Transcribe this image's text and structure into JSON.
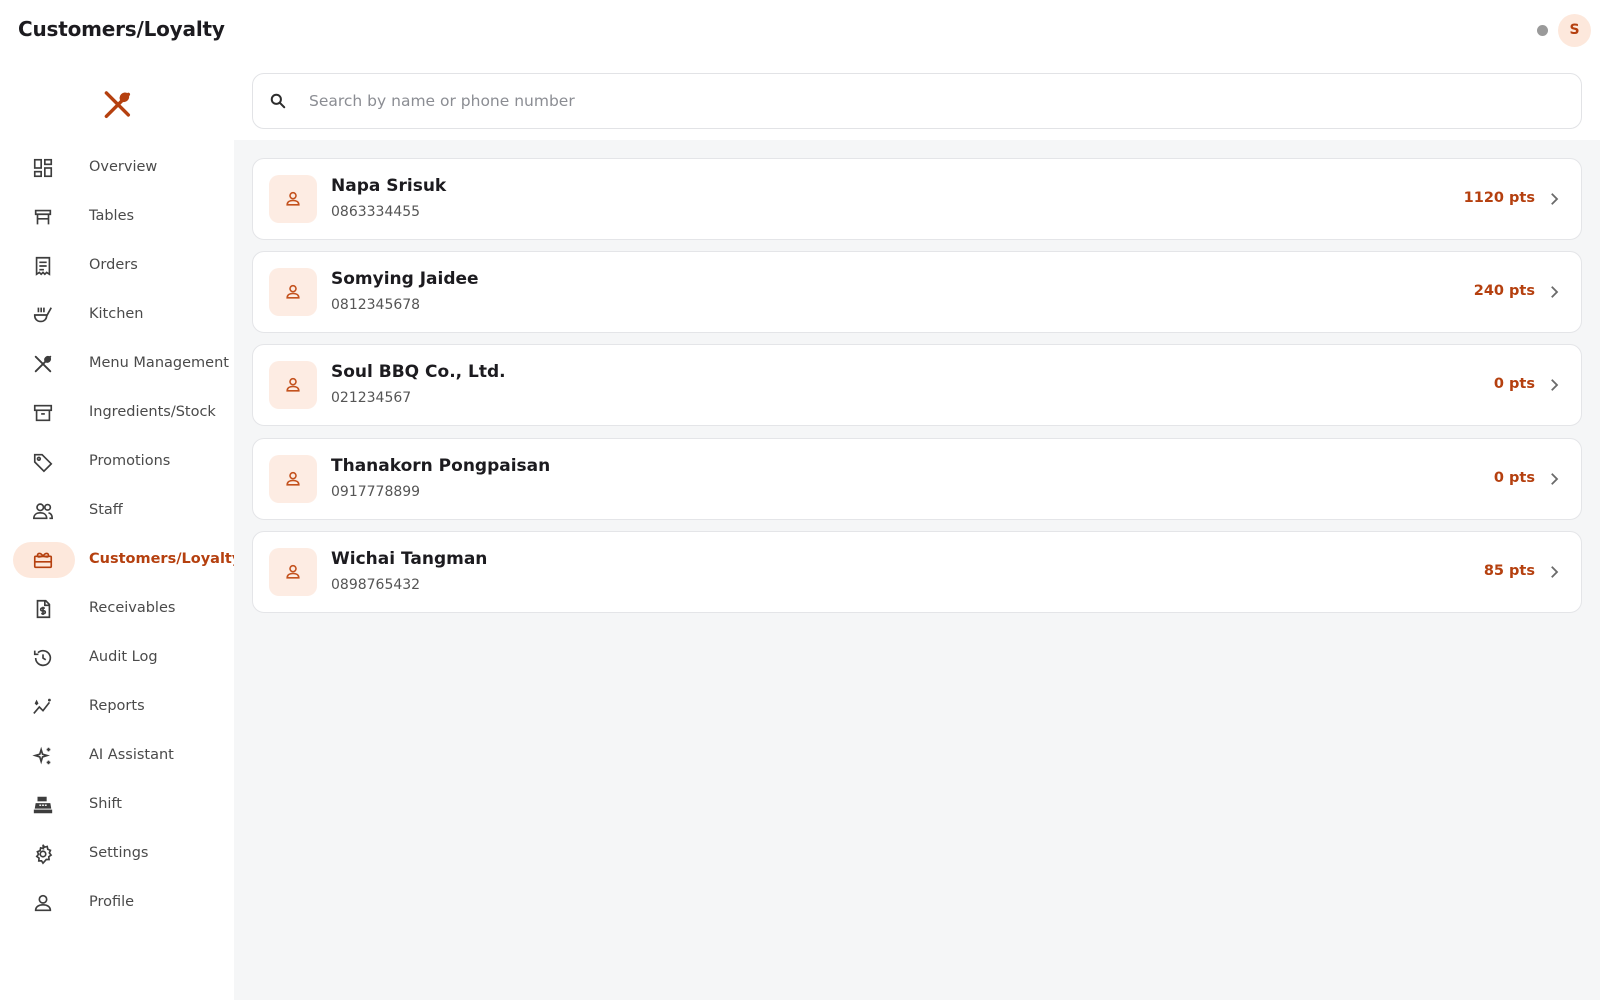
{
  "header": {
    "title": "Customers/Loyalty",
    "avatar_initial": "S"
  },
  "sidebar": {
    "items": [
      {
        "label": "Overview",
        "icon": "dashboard-icon"
      },
      {
        "label": "Tables",
        "icon": "table-icon"
      },
      {
        "label": "Orders",
        "icon": "receipt-icon"
      },
      {
        "label": "Kitchen",
        "icon": "kitchen-icon"
      },
      {
        "label": "Menu Management",
        "icon": "utensils-icon"
      },
      {
        "label": "Ingredients/Stock",
        "icon": "archive-box-icon"
      },
      {
        "label": "Promotions",
        "icon": "tag-icon"
      },
      {
        "label": "Staff",
        "icon": "people-icon"
      },
      {
        "label": "Customers/Loyalty",
        "icon": "loyalty-card-icon",
        "active": true
      },
      {
        "label": "Receivables",
        "icon": "invoice-dollar-icon"
      },
      {
        "label": "Audit Log",
        "icon": "history-icon"
      },
      {
        "label": "Reports",
        "icon": "trend-chart-icon"
      },
      {
        "label": "AI Assistant",
        "icon": "sparkles-icon"
      },
      {
        "label": "Shift",
        "icon": "cash-register-icon"
      },
      {
        "label": "Settings",
        "icon": "gear-icon"
      },
      {
        "label": "Profile",
        "icon": "person-icon"
      }
    ]
  },
  "search": {
    "placeholder": "Search by name or phone number",
    "value": ""
  },
  "customers": [
    {
      "name": "Napa Srisuk",
      "phone": "0863334455",
      "points": "1120 pts"
    },
    {
      "name": "Somying Jaidee",
      "phone": "0812345678",
      "points": "240 pts"
    },
    {
      "name": "Soul BBQ Co., Ltd.",
      "phone": "021234567",
      "points": "0 pts"
    },
    {
      "name": "Thanakorn Pongpaisan",
      "phone": "0917778899",
      "points": "0 pts"
    },
    {
      "name": "Wichai Tangman",
      "phone": "0898765432",
      "points": "85 pts"
    }
  ],
  "colors": {
    "accent": "#b5400f",
    "accent_soft": "#fde8dc",
    "background": "#f5f6f7"
  }
}
